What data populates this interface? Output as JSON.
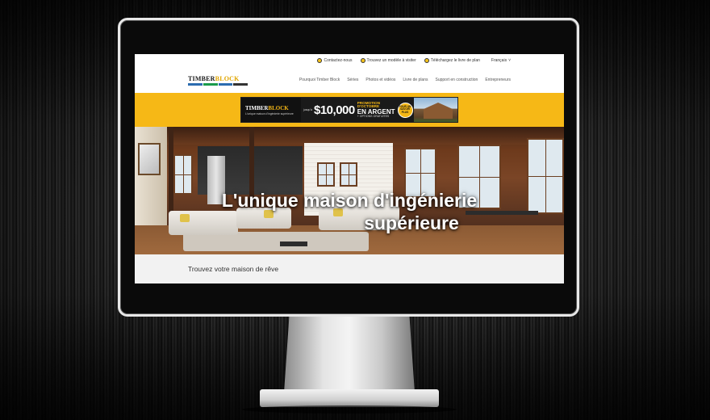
{
  "topbar": {
    "links": [
      {
        "label": "Contactez-nous",
        "icon": "phone-icon"
      },
      {
        "label": "Trouvez un modèle à visiter",
        "icon": "location-icon"
      },
      {
        "label": "Téléchargez le livre de plan",
        "icon": "download-icon"
      }
    ],
    "language": "Français"
  },
  "logo": {
    "part1": "TIMBER",
    "part2": "BLOCK",
    "stripe_colors": [
      "#2b6cb0",
      "#1a9b4a",
      "#2b6cb0",
      "#333333"
    ]
  },
  "nav": {
    "items": [
      "Pourquoi Timber Block",
      "Séries",
      "Photos et vidéos",
      "Livre de plans",
      "Support en construction",
      "Entrepreneurs"
    ]
  },
  "promo": {
    "logo_part1": "TIMBER",
    "logo_part2": "BLOCK",
    "tagline": "L'unique maison d'ingénierie supérieure",
    "prefix": "jusqu'à",
    "amount": "$10,000",
    "line1": "PROMOTION D'OCTOBRE",
    "line2": "EN ARGENT",
    "line3": "+ OPTIONS GRATUITES",
    "badge": "POUR UN SAVOIR PLUS"
  },
  "hero": {
    "title_line1": "L'unique maison d'ingénierie",
    "title_line2": "supérieure"
  },
  "section": {
    "title": "Trouvez votre maison de rêve"
  },
  "colors": {
    "accent": "#f6b816",
    "dark": "#111111"
  }
}
